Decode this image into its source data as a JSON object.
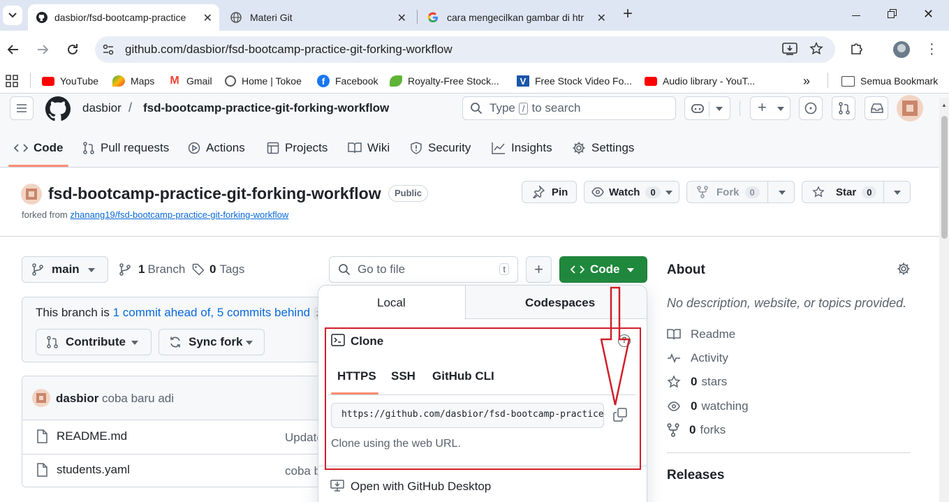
{
  "browser": {
    "tabs": [
      {
        "title": "dasbior/fsd-bootcamp-practice",
        "active": true
      },
      {
        "title": "Materi Git"
      },
      {
        "title": "cara mengecilkan gambar di htr"
      }
    ],
    "url": "github.com/dasbior/fsd-bootcamp-practice-git-forking-workflow",
    "bookmarks": [
      "YouTube",
      "Maps",
      "Gmail",
      "Home | Tokoe",
      "Facebook",
      "Royalty-Free Stock...",
      "Free Stock Video Fo...",
      "Audio library - YouT..."
    ],
    "bookmarks_more": "»",
    "all_bookmarks": "Semua Bookmark"
  },
  "header": {
    "owner": "dasbior",
    "sep": "/",
    "repo": "fsd-bootcamp-practice-git-forking-workflow",
    "search_type": "Type",
    "search_key": "/",
    "search_suffix": "to search"
  },
  "nav": [
    "Code",
    "Pull requests",
    "Actions",
    "Projects",
    "Wiki",
    "Security",
    "Insights",
    "Settings"
  ],
  "repo": {
    "name": "fsd-bootcamp-practice-git-forking-workflow",
    "visibility": "Public",
    "forked_prefix": "forked from",
    "forked_link": "zhanang19/fsd-bootcamp-practice-git-forking-workflow",
    "pin": "Pin",
    "watch": "Watch",
    "watch_count": "0",
    "fork": "Fork",
    "fork_count": "0",
    "star": "Star",
    "star_count": "0"
  },
  "files": {
    "branch": "main",
    "branches_count": "1",
    "branches_label": "Branch",
    "tags_count": "0",
    "tags_label": "Tags",
    "go_to_file": "Go to file",
    "go_to_file_key": "t",
    "code_button": "Code",
    "branch_status_prefix": "This branch is",
    "ahead": "1 commit ahead of,",
    "behind": "5 commits behind",
    "behind_target": "zh",
    "contribute": "Contribute",
    "sync_fork": "Sync fork",
    "commit_author": "dasbior",
    "commit_message": "coba baru adi",
    "rows": [
      {
        "name": "README.md",
        "message": "Update"
      },
      {
        "name": "students.yaml",
        "message": "coba b"
      }
    ]
  },
  "clone_popup": {
    "tabs": [
      "Local",
      "Codespaces"
    ],
    "clone_title": "Clone",
    "help": "?",
    "protocols": [
      "HTTPS",
      "SSH",
      "GitHub CLI"
    ],
    "url": "https://github.com/dasbior/fsd-bootcamp-practice-git-forking-workflow.git",
    "hint": "Clone using the web URL.",
    "desktop": "Open with GitHub Desktop",
    "annotation_color": "#d0202a"
  },
  "about": {
    "title": "About",
    "description": "No description, website, or topics provided.",
    "readme": "Readme",
    "activity": "Activity",
    "stars_count": "0",
    "stars_label": "stars",
    "watching_count": "0",
    "watching_label": "watching",
    "forks_count": "0",
    "forks_label": "forks",
    "releases": "Releases"
  },
  "colors": {
    "code_green": "#1f883d",
    "link": "#0969da",
    "nav_underline": "#fd8c73"
  }
}
